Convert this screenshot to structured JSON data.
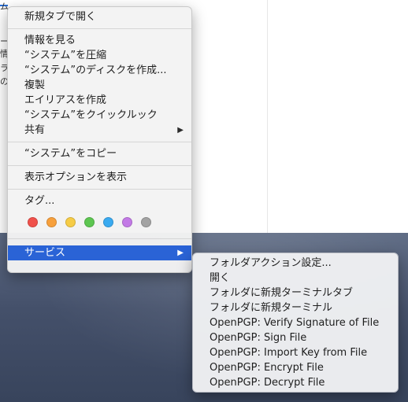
{
  "menu": {
    "items": [
      {
        "label": "新規タブで開く"
      },
      {
        "label": "情報を見る"
      },
      {
        "label": "“システム”を圧縮"
      },
      {
        "label": "“システム”のディスクを作成..."
      },
      {
        "label": "複製"
      },
      {
        "label": "エイリアスを作成"
      },
      {
        "label": "“システム”をクイックルック"
      },
      {
        "label": "共有",
        "arrow": "▶"
      },
      {
        "label": "“システム”をコピー"
      },
      {
        "label": "表示オプションを表示"
      },
      {
        "label": "タグ..."
      },
      {
        "label": "サービス",
        "arrow": "▶"
      }
    ],
    "tag_colors": [
      "#f0514b",
      "#f7a03c",
      "#f6cc46",
      "#5dc651",
      "#3aaaf0",
      "#c37ae6",
      "#a3a3a3"
    ]
  },
  "submenu": {
    "items": [
      "フォルダアクション設定...",
      "開く",
      "フォルダに新規ターミナルタブ",
      "フォルダに新規ターミナル",
      "OpenPGP: Verify Signature of File",
      "OpenPGP: Sign File",
      "OpenPGP: Import Key from File",
      "OpenPGP: Encrypt File",
      "OpenPGP: Decrypt File"
    ]
  },
  "background": {
    "left_fragments": [
      "ム",
      "ー",
      "情",
      "ラ",
      "の"
    ]
  },
  "colors": {
    "selection": "#2a63d6",
    "desktop": "#44506a"
  }
}
